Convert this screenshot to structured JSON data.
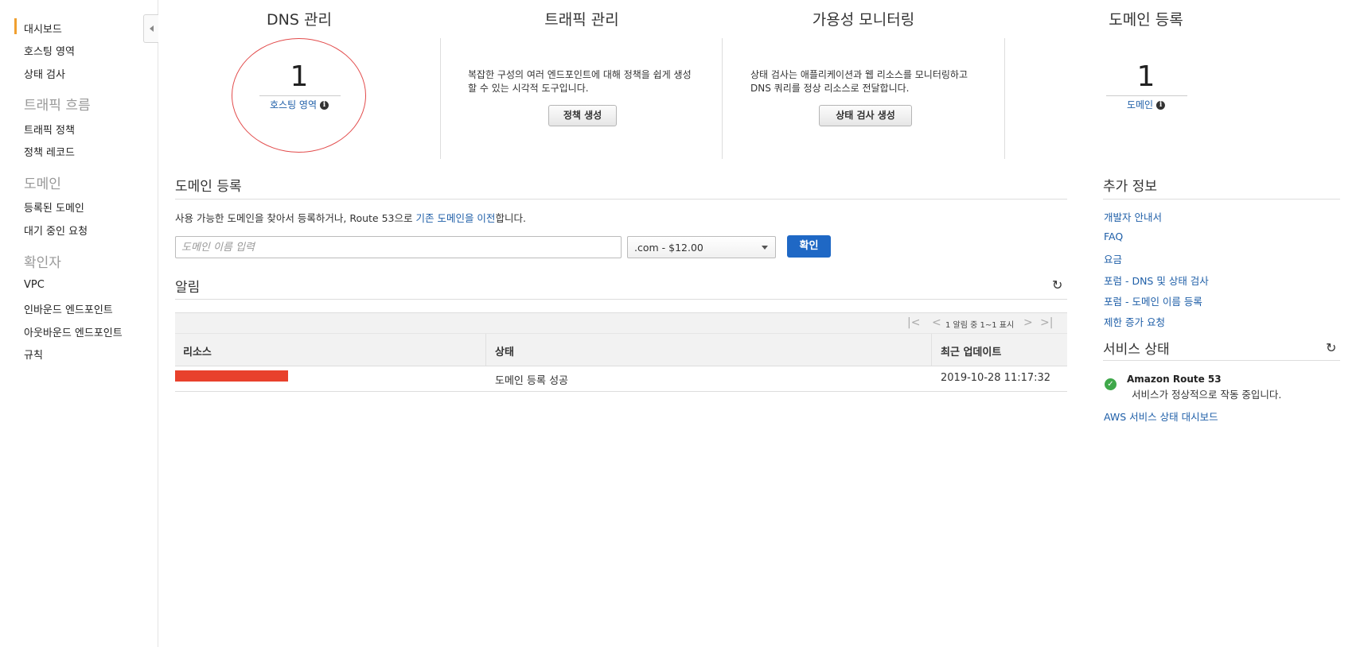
{
  "sidebar": {
    "items": [
      {
        "label": "대시보드"
      },
      {
        "label": "호스팅 영역"
      },
      {
        "label": "상태 검사"
      },
      {
        "label": "트래픽 흐름"
      },
      {
        "label": "트래픽 정책"
      },
      {
        "label": "정책 레코드"
      },
      {
        "label": "도메인"
      },
      {
        "label": "등록된 도메인"
      },
      {
        "label": "대기 중인 요청"
      },
      {
        "label": "확인자"
      },
      {
        "label": "VPC"
      },
      {
        "label": "인바운드 엔드포인트"
      },
      {
        "label": "아웃바운드 엔드포인트"
      },
      {
        "label": "규칙"
      }
    ]
  },
  "cards": {
    "dns": {
      "title": "DNS 관리",
      "count": "1",
      "link": "호스팅 영역"
    },
    "traffic": {
      "title": "트래픽 관리",
      "desc": "복잡한 구성의 여러 엔드포인트에 대해 정책을 쉽게 생성할 수 있는 시각적 도구입니다.",
      "button": "정책 생성"
    },
    "availability": {
      "title": "가용성 모니터링",
      "desc": "상태 검사는 애플리케이션과 웹 리소스를 모니터링하고 DNS 쿼리를 정상 리소스로 전달합니다.",
      "button": "상태 검사 생성"
    },
    "domain": {
      "title": "도메인 등록",
      "count": "1",
      "link": "도메인"
    }
  },
  "domain_registration": {
    "title": "도메인 등록",
    "intro_before": "사용 가능한 도메인을 찾아서 등록하거나, Route 53으로 ",
    "intro_link": "기존 도메인을 이전",
    "intro_after": "합니다.",
    "input_placeholder": "도메인 이름 입력",
    "tld_selected": ".com - $12.00",
    "confirm_button": "확인"
  },
  "alerts": {
    "title": "알림",
    "pager_text": "1 알림 중 1~1 표시",
    "columns": [
      "리소스",
      "상태",
      "최근 업데이트"
    ],
    "rows": [
      {
        "resource": "",
        "status": "도메인 등록 성공",
        "updated": "2019-10-28 11:17:32"
      }
    ]
  },
  "more_info": {
    "title": "추가 정보",
    "links": [
      "개발자 안내서",
      "FAQ",
      "요금",
      "포럼 - DNS 및 상태 검사",
      "포럼 - 도메인 이름 등록",
      "제한 증가 요청"
    ]
  },
  "service_health": {
    "title": "서비스 상태",
    "service_name": "Amazon Route 53",
    "status_text": "서비스가 정상적으로 작동 중입니다.",
    "dashboard_link": "AWS 서비스 상태 대시보드"
  },
  "colors": {
    "accent": "#f0a030",
    "link": "#1f5fa8",
    "primary_button": "#1f68c5",
    "highlight_circle": "#e24a4a",
    "redaction": "#e8412c",
    "ok": "#3fa84a"
  }
}
